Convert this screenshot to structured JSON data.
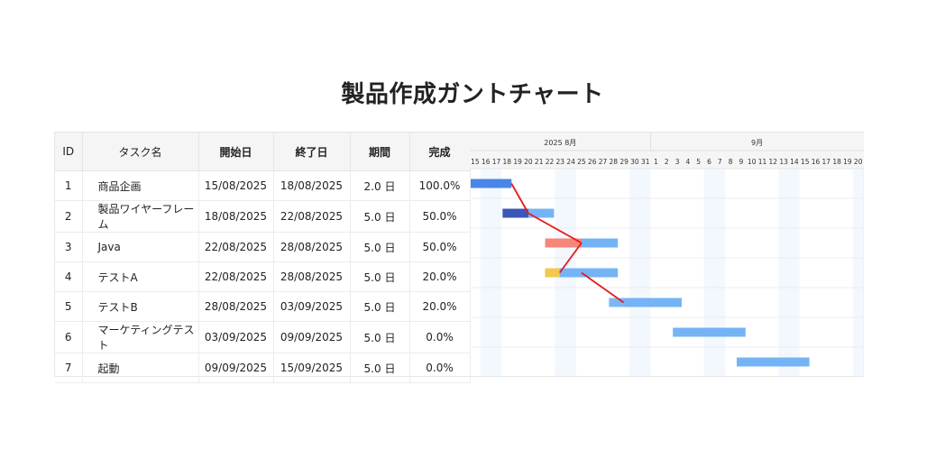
{
  "page": {
    "title": "製品作成ガントチャート"
  },
  "table": {
    "columns": {
      "id": "ID",
      "name": "タスク名",
      "start": "開始日",
      "end": "終了日",
      "duration": "期間",
      "progress": "完成"
    },
    "rows": [
      {
        "id": "1",
        "name": "商品企画",
        "start": "15/08/2025",
        "end": "18/08/2025",
        "duration": "2.0 日",
        "progress": "100.0%"
      },
      {
        "id": "2",
        "name": "製品ワイヤーフレーム",
        "start": "18/08/2025",
        "end": "22/08/2025",
        "duration": "5.0 日",
        "progress": "50.0%"
      },
      {
        "id": "3",
        "name": "Java",
        "start": "22/08/2025",
        "end": "28/08/2025",
        "duration": "5.0 日",
        "progress": "50.0%"
      },
      {
        "id": "4",
        "name": "テストA",
        "start": "22/08/2025",
        "end": "28/08/2025",
        "duration": "5.0 日",
        "progress": "20.0%"
      },
      {
        "id": "5",
        "name": "テストB",
        "start": "28/08/2025",
        "end": "03/09/2025",
        "duration": "5.0 日",
        "progress": "20.0%"
      },
      {
        "id": "6",
        "name": "マーケティングテスト",
        "start": "03/09/2025",
        "end": "09/09/2025",
        "duration": "5.0 日",
        "progress": "0.0%"
      },
      {
        "id": "7",
        "name": "起動",
        "start": "09/09/2025",
        "end": "15/09/2025",
        "duration": "5.0 日",
        "progress": "0.0%"
      }
    ]
  },
  "timeline": {
    "months": [
      {
        "label": "2025 8月",
        "days": 17
      },
      {
        "label": "9月",
        "days": 20
      }
    ],
    "days": [
      "15",
      "16",
      "17",
      "18",
      "19",
      "20",
      "21",
      "22",
      "23",
      "24",
      "25",
      "26",
      "27",
      "28",
      "29",
      "30",
      "31",
      "1",
      "2",
      "3",
      "4",
      "5",
      "6",
      "7",
      "8",
      "9",
      "10",
      "11",
      "12",
      "13",
      "14",
      "15",
      "16",
      "17",
      "18",
      "19",
      "20"
    ],
    "weekend_day_indices": [
      1,
      2,
      8,
      9,
      15,
      16,
      22,
      23,
      29,
      30,
      36
    ]
  },
  "chart_data": {
    "type": "gantt",
    "tasks": [
      {
        "id": "1",
        "start_day_index": 0,
        "span_days": 4,
        "progress": 1.0,
        "progress_color": "#4a86e8"
      },
      {
        "id": "2",
        "start_day_index": 3,
        "span_days": 5,
        "progress": 0.5,
        "progress_color": "#3a56b8"
      },
      {
        "id": "3",
        "start_day_index": 7,
        "span_days": 7,
        "progress": 0.5,
        "progress_color": "#f4867a"
      },
      {
        "id": "4",
        "start_day_index": 7,
        "span_days": 7,
        "progress": 0.2,
        "progress_color": "#f2c94c"
      },
      {
        "id": "5",
        "start_day_index": 13,
        "span_days": 7,
        "progress": 0.2,
        "progress_color": "#7db8f5"
      },
      {
        "id": "6",
        "start_day_index": 19,
        "span_days": 7,
        "progress": 0.0,
        "progress_color": "#74b4f5"
      },
      {
        "id": "7",
        "start_day_index": 25,
        "span_days": 7,
        "progress": 0.0,
        "progress_color": "#74b4f5"
      }
    ],
    "bar_color": "#74b4f5",
    "dependencies": [
      [
        "1",
        "2"
      ],
      [
        "2",
        "3"
      ],
      [
        "3",
        "4"
      ],
      [
        "4",
        "5"
      ]
    ],
    "dependency_color": "#e31b1b"
  }
}
